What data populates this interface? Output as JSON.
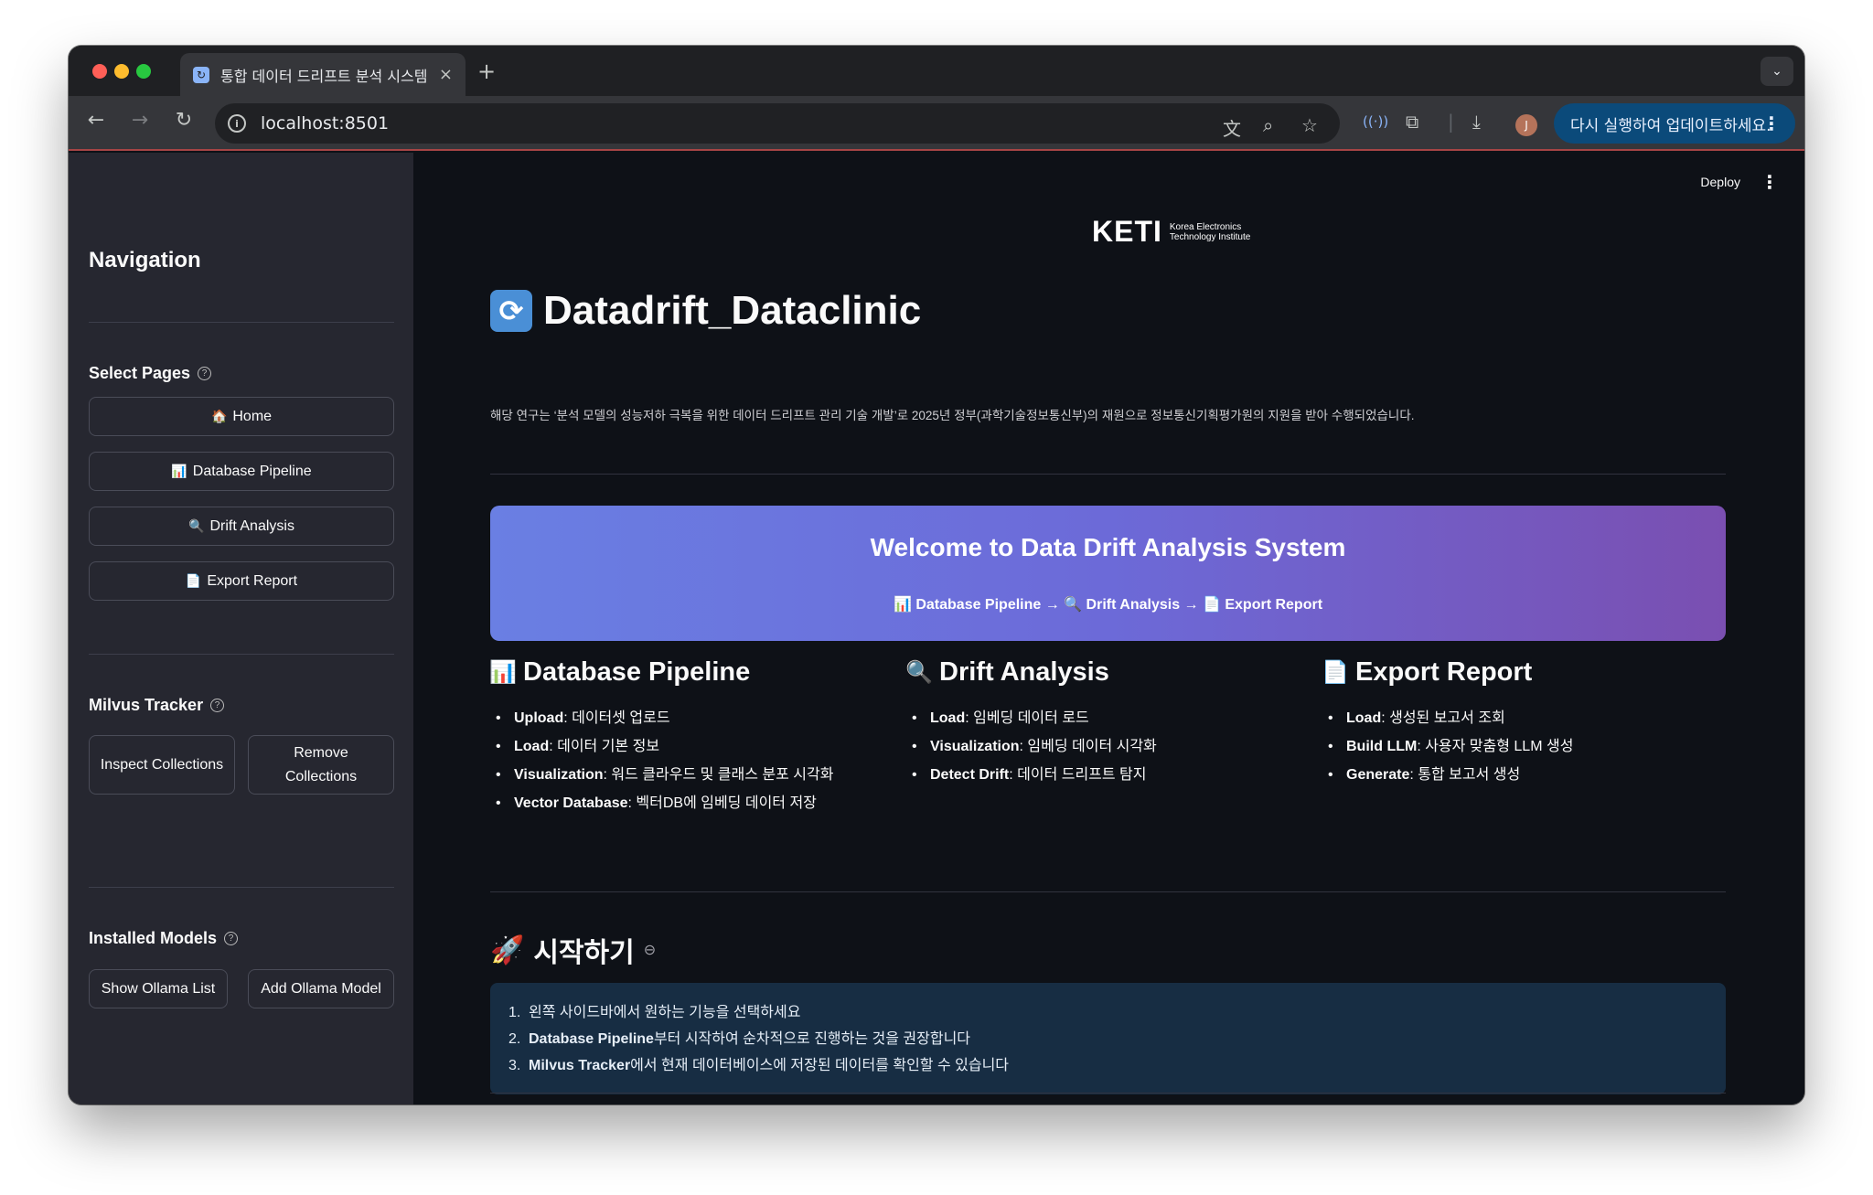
{
  "browser": {
    "tab_title": "통합 데이터 드리프트 분석 시스템",
    "url": "localhost:8501",
    "update_label": "다시 실행하여 업데이트하세요.",
    "profile_initial": "J",
    "new_tab_glyph": "+",
    "close_glyph": "×"
  },
  "sidebar": {
    "title": "Navigation",
    "select_pages_label": "Select Pages",
    "pages": [
      {
        "icon": "🏠",
        "label": "Home"
      },
      {
        "icon": "📊",
        "label": "Database Pipeline"
      },
      {
        "icon": "🔍",
        "label": "Drift Analysis"
      },
      {
        "icon": "📄",
        "label": "Export Report"
      }
    ],
    "milvus_label": "Milvus Tracker",
    "inspect_label": "Inspect Collections",
    "remove_label": "Remove Collections",
    "models_label": "Installed Models",
    "show_models_label": "Show Ollama List",
    "add_model_label": "Add Ollama Model"
  },
  "header": {
    "deploy_label": "Deploy"
  },
  "logo": {
    "mark": "KETI",
    "line1": "Korea Electronics",
    "line2": "Technology Institute"
  },
  "main": {
    "title": "Datadrift_Dataclinic",
    "title_icon": "🔄",
    "subtitle": "해당 연구는 ‘분석 모델의 성능저하 극복을 위한 데이터 드리프트 관리 기술 개발’로 2025년 정부(과학기술정보통신부)의 재원으로 정보통신기획평가원의 지원을 받아 수행되었습니다.",
    "banner_title": "Welcome to Data Drift Analysis System",
    "banner_flow": "📊 Database Pipeline → 🔍 Drift Analysis → 📄 Export Report",
    "features": [
      {
        "icon": "📊",
        "title": "Database Pipeline",
        "items": [
          {
            "key": "Upload",
            "text": ": 데이터셋 업로드"
          },
          {
            "key": "Load",
            "text": ": 데이터 기본 정보"
          },
          {
            "key": "Visualization",
            "text": ": 워드 클라우드 및 클래스 분포 시각화"
          },
          {
            "key": "Vector Database",
            "text": ": 벡터DB에 임베딩 데이터 저장"
          }
        ]
      },
      {
        "icon": "🔍",
        "title": "Drift Analysis",
        "items": [
          {
            "key": "Load",
            "text": ": 임베딩 데이터 로드"
          },
          {
            "key": "Visualization",
            "text": ": 임베딩 데이터 시각화"
          },
          {
            "key": "Detect Drift",
            "text": ": 데이터 드리프트 탐지"
          }
        ]
      },
      {
        "icon": "📄",
        "title": "Export Report",
        "items": [
          {
            "key": "Load",
            "text": ": 생성된 보고서 조회"
          },
          {
            "key": "Build LLM",
            "text": ": 사용자 맞춤형 LLM 생성"
          },
          {
            "key": "Generate",
            "text": ": 통합 보고서 생성"
          }
        ]
      }
    ],
    "getting_started_icon": "🚀",
    "getting_started_title": "시작하기",
    "steps": [
      {
        "num": "1.",
        "bold": "",
        "text": "왼쪽 사이드바에서 원하는 기능을 선택하세요"
      },
      {
        "num": "2.",
        "bold": "Database Pipeline",
        "text": "부터 시작하여 순차적으로 진행하는 것을 권장합니다"
      },
      {
        "num": "3.",
        "bold": "Milvus Tracker",
        "text": "에서 현재 데이터베이스에 저장된 데이터를 확인할 수 있습니다"
      }
    ]
  }
}
